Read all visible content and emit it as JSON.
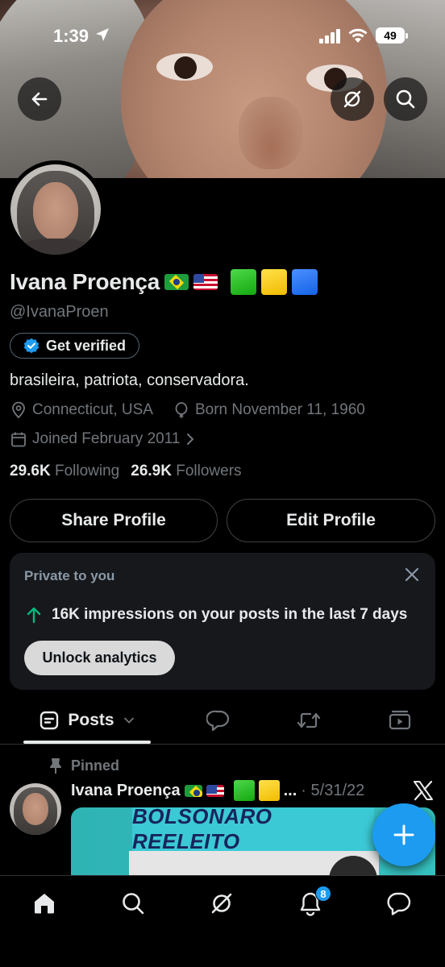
{
  "status_bar": {
    "time": "1:39",
    "battery": "49"
  },
  "profile": {
    "name": "Ivana Proença",
    "handle": "@IvanaProen",
    "verify_label": "Get verified",
    "bio": "brasileira, patriota, conservadora.",
    "location": "Connecticut, USA",
    "born": "Born November 11, 1960",
    "joined": "Joined February 2011",
    "following_count": "29.6K",
    "following_label": "Following",
    "followers_count": "26.9K",
    "followers_label": "Followers"
  },
  "actions": {
    "share_label": "Share Profile",
    "edit_label": "Edit Profile"
  },
  "private_card": {
    "title": "Private to you",
    "impressions": "16K impressions on your posts in the last 7 days",
    "unlock_label": "Unlock analytics"
  },
  "tabs": {
    "posts_label": "Posts"
  },
  "pinned_post": {
    "pinned_label": "Pinned",
    "author": "Ivana Proença",
    "ellipsis": "...",
    "date": "· 5/31/22",
    "media_text": "BOLSONARO REELEITO"
  },
  "bottom_nav": {
    "notification_count": "8"
  },
  "colors": {
    "accent": "#1d9bf0",
    "background": "#000000",
    "muted": "#71767b",
    "text": "#e7e9ea",
    "up_arrow": "#00ba7c"
  },
  "icons": [
    "back-arrow-icon",
    "grok-icon",
    "search-icon",
    "verified-badge-icon",
    "location-pin-icon",
    "birthday-balloon-icon",
    "calendar-icon",
    "chevron-right-icon",
    "close-icon",
    "up-arrow-icon",
    "chevron-down-icon",
    "reply-icon",
    "repost-icon",
    "media-icon",
    "pin-icon",
    "x-logo-icon",
    "plus-icon",
    "home-icon",
    "bell-icon",
    "messages-icon"
  ]
}
